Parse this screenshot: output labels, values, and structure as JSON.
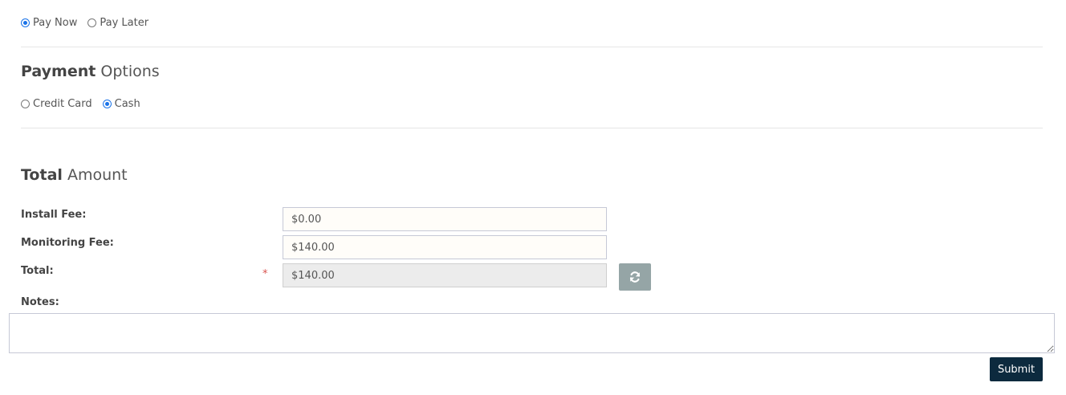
{
  "payment_timing": {
    "options": [
      {
        "label": "Pay Now",
        "checked": true
      },
      {
        "label": "Pay Later",
        "checked": false
      }
    ]
  },
  "payment_options": {
    "title_bold": "Payment",
    "title_light": "Options",
    "options": [
      {
        "label": "Credit Card",
        "checked": false
      },
      {
        "label": "Cash",
        "checked": true
      }
    ]
  },
  "total_amount": {
    "title_bold": "Total",
    "title_light": "Amount",
    "install_fee_label": "Install Fee:",
    "install_fee_value": "$0.00",
    "monitoring_fee_label": "Monitoring Fee:",
    "monitoring_fee_value": "$140.00",
    "total_label": "Total:",
    "total_value": "$140.00",
    "required_mark": "*",
    "refresh_icon": "refresh-icon"
  },
  "notes": {
    "label": "Notes:",
    "value": ""
  },
  "actions": {
    "submit_label": "Submit"
  },
  "colors": {
    "radio_accent": "#1a73e8",
    "refresh_button": "#95a5a6",
    "submit_button": "#0c2a3e",
    "required": "#d9534f"
  }
}
